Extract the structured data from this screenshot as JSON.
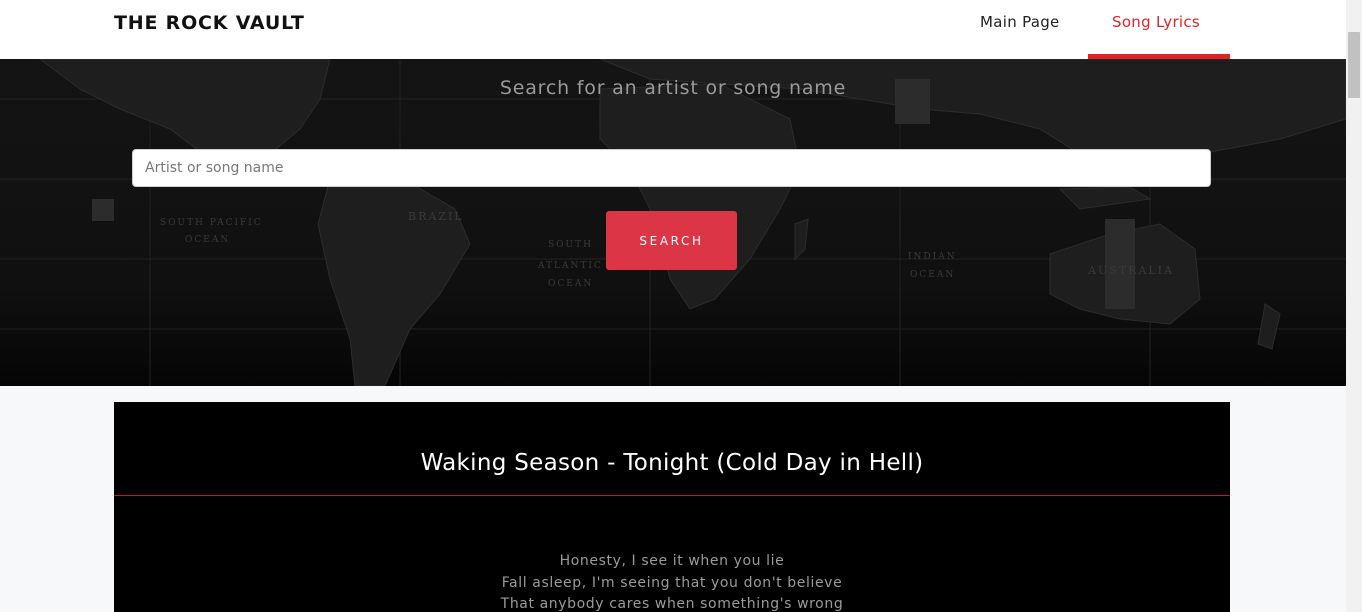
{
  "navbar": {
    "brand": "THE ROCK VAULT",
    "links": [
      {
        "label": "Main Page",
        "active": false
      },
      {
        "label": "Song Lyrics",
        "active": true
      }
    ],
    "active_color": "#e02424"
  },
  "hero": {
    "title": "Search for an artist or song name",
    "search_placeholder": "Artist or song name",
    "search_value": "",
    "button_label": "SEARCH",
    "map_labels": [
      "SOUTH PACIFIC",
      "OCEAN",
      "BRAZIL",
      "SOUTH",
      "ATLANTIC",
      "OCEAN",
      "INDIAN",
      "OCEAN",
      "AUSTRALIA"
    ],
    "accent_color": "#dc3545"
  },
  "song": {
    "title": "Waking Season - Tonight (Cold Day in Hell)",
    "lyrics": [
      "Honesty, I see it when you lie",
      "Fall asleep, I'm seeing that you don't believe",
      "That anybody cares when something's wrong"
    ]
  }
}
